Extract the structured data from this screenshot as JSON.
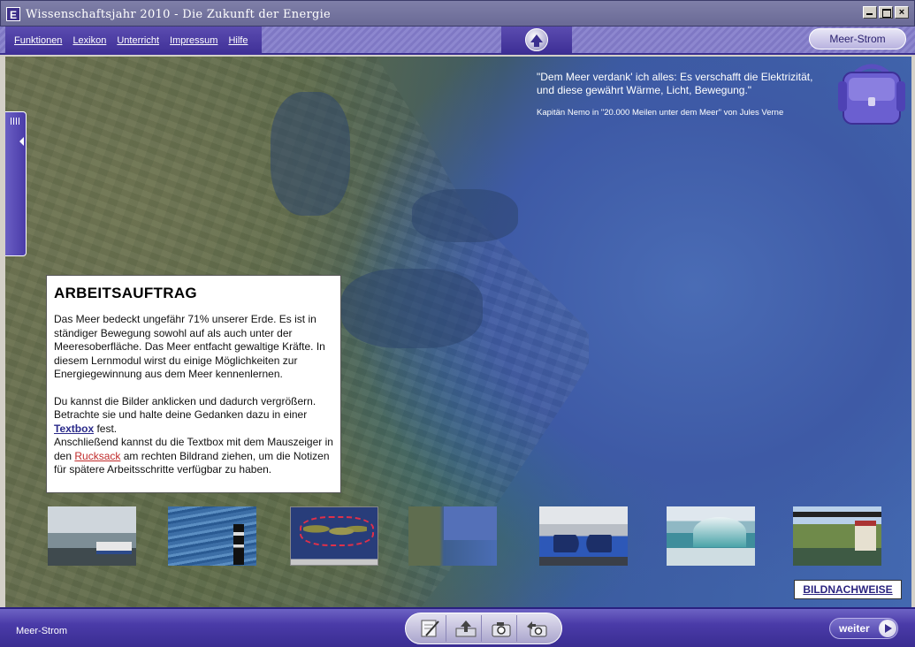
{
  "window": {
    "app_icon_letter": "E",
    "title": "Wissenschaftsjahr 2010 - Die Zukunft der Energie"
  },
  "nav": {
    "menu": [
      {
        "label": "Funktionen"
      },
      {
        "label": "Lexikon"
      },
      {
        "label": "Unterricht"
      },
      {
        "label": "Impressum"
      },
      {
        "label": "Hilfe"
      }
    ],
    "up_icon": "up-arrow-icon",
    "topic_button": "Meer-Strom"
  },
  "quote": {
    "text": "\"Dem Meer verdank' ich alles: Es verschafft die Elektrizität, und diese gewährt Wärme, Licht, Bewegung.\"",
    "source": "Kapitän Nemo in \"20.000 Meilen unter dem Meer\" von Jules Verne"
  },
  "backpack_icon": "backpack-icon",
  "task": {
    "heading": "ARBEITSAUFTRAG",
    "para1": "Das Meer bedeckt ungefähr 71% unserer Erde. Es ist in ständiger Bewegung sowohl auf als auch unter der Meeresoberfläche. Das Meer entfacht gewaltige Kräfte. In diesem Lernmodul wirst du einige Möglichkeiten zur Energiegewinnung aus dem Meer kennenlernen.",
    "para2_a": "Du kannst die Bilder anklicken und dadurch vergrößern. Betrachte sie und halte deine Gedanken dazu in einer",
    "link_textbox": "Textbox",
    "para2_b": "fest.",
    "para3_a": "Anschließend kannst du die Textbox mit dem Mauszeiger in den",
    "link_rucksack": "Rucksack",
    "para3_b": "am rechten Bildrand ziehen, um die Notizen für spätere Arbeitsschritte verfügbar zu haben."
  },
  "thumbnails": [
    {
      "name": "harbor-photo"
    },
    {
      "name": "water-gauge-photo"
    },
    {
      "name": "ocean-currents-map"
    },
    {
      "name": "coast-satellite-photo"
    },
    {
      "name": "turbine-hall-photo"
    },
    {
      "name": "wave-photo"
    },
    {
      "name": "tidal-plant-photo"
    }
  ],
  "credits_link": "BILDNACHWEISE",
  "footer": {
    "label": "Meer-Strom",
    "tools": [
      {
        "icon": "notepad-pen-icon"
      },
      {
        "icon": "upload-icon"
      },
      {
        "icon": "camera-icon"
      },
      {
        "icon": "camera-export-icon"
      }
    ],
    "next_label": "weiter"
  },
  "colors": {
    "chrome_purple": "#4a3ba8",
    "nav_stripes": "#8d87cf",
    "link_blue": "#2a2a8a",
    "link_red": "#c02a2a"
  }
}
